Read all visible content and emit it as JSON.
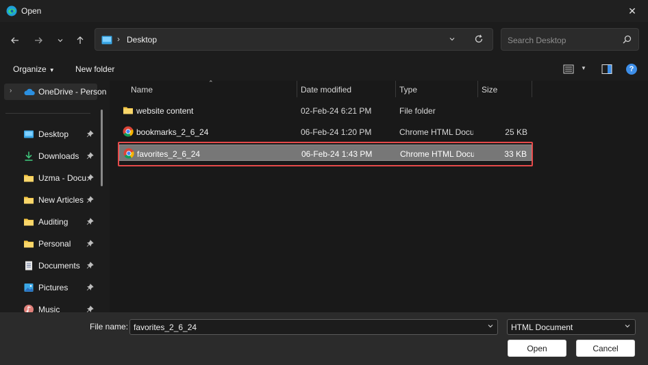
{
  "window": {
    "title": "Open"
  },
  "nav": {
    "address_path": "Desktop",
    "address_separator": "›",
    "search_placeholder": "Search Desktop"
  },
  "toolbar": {
    "organize_label": "Organize",
    "new_folder_label": "New folder"
  },
  "sidebar": {
    "onedrive_label": "OneDrive - Personal",
    "items": [
      {
        "label": "Desktop",
        "icon": "desktop-icon",
        "pinned": true
      },
      {
        "label": "Downloads",
        "icon": "download-icon",
        "pinned": true
      },
      {
        "label": "Uzma - Documents",
        "icon": "folder-icon",
        "pinned": true
      },
      {
        "label": "New Articles",
        "icon": "folder-icon",
        "pinned": true
      },
      {
        "label": "Auditing",
        "icon": "folder-icon",
        "pinned": true
      },
      {
        "label": "Personal",
        "icon": "folder-icon",
        "pinned": true
      },
      {
        "label": "Documents",
        "icon": "documents-icon",
        "pinned": true
      },
      {
        "label": "Pictures",
        "icon": "pictures-icon",
        "pinned": true
      },
      {
        "label": "Music",
        "icon": "music-icon",
        "pinned": true
      }
    ]
  },
  "columns": {
    "name": "Name",
    "date": "Date modified",
    "type": "Type",
    "size": "Size"
  },
  "files": [
    {
      "name": "website content",
      "date": "02-Feb-24 6:21 PM",
      "type": "File folder",
      "size": "",
      "icon": "folder-icon"
    },
    {
      "name": "bookmarks_2_6_24",
      "date": "06-Feb-24 1:20 PM",
      "type": "Chrome HTML Document",
      "size": "25 KB",
      "icon": "chrome-icon"
    },
    {
      "name": "favorites_2_6_24",
      "date": "06-Feb-24 1:43 PM",
      "type": "Chrome HTML Document",
      "size": "33 KB",
      "icon": "chrome-icon",
      "selected": true
    }
  ],
  "bottom": {
    "file_name_label": "File name:",
    "file_name_value": "favorites_2_6_24",
    "file_type_value": "HTML Document",
    "open_label": "Open",
    "cancel_label": "Cancel"
  },
  "colors": {
    "accent": "#3d8ee8",
    "highlight": "#e64a4a",
    "folder": "#f4c542"
  }
}
